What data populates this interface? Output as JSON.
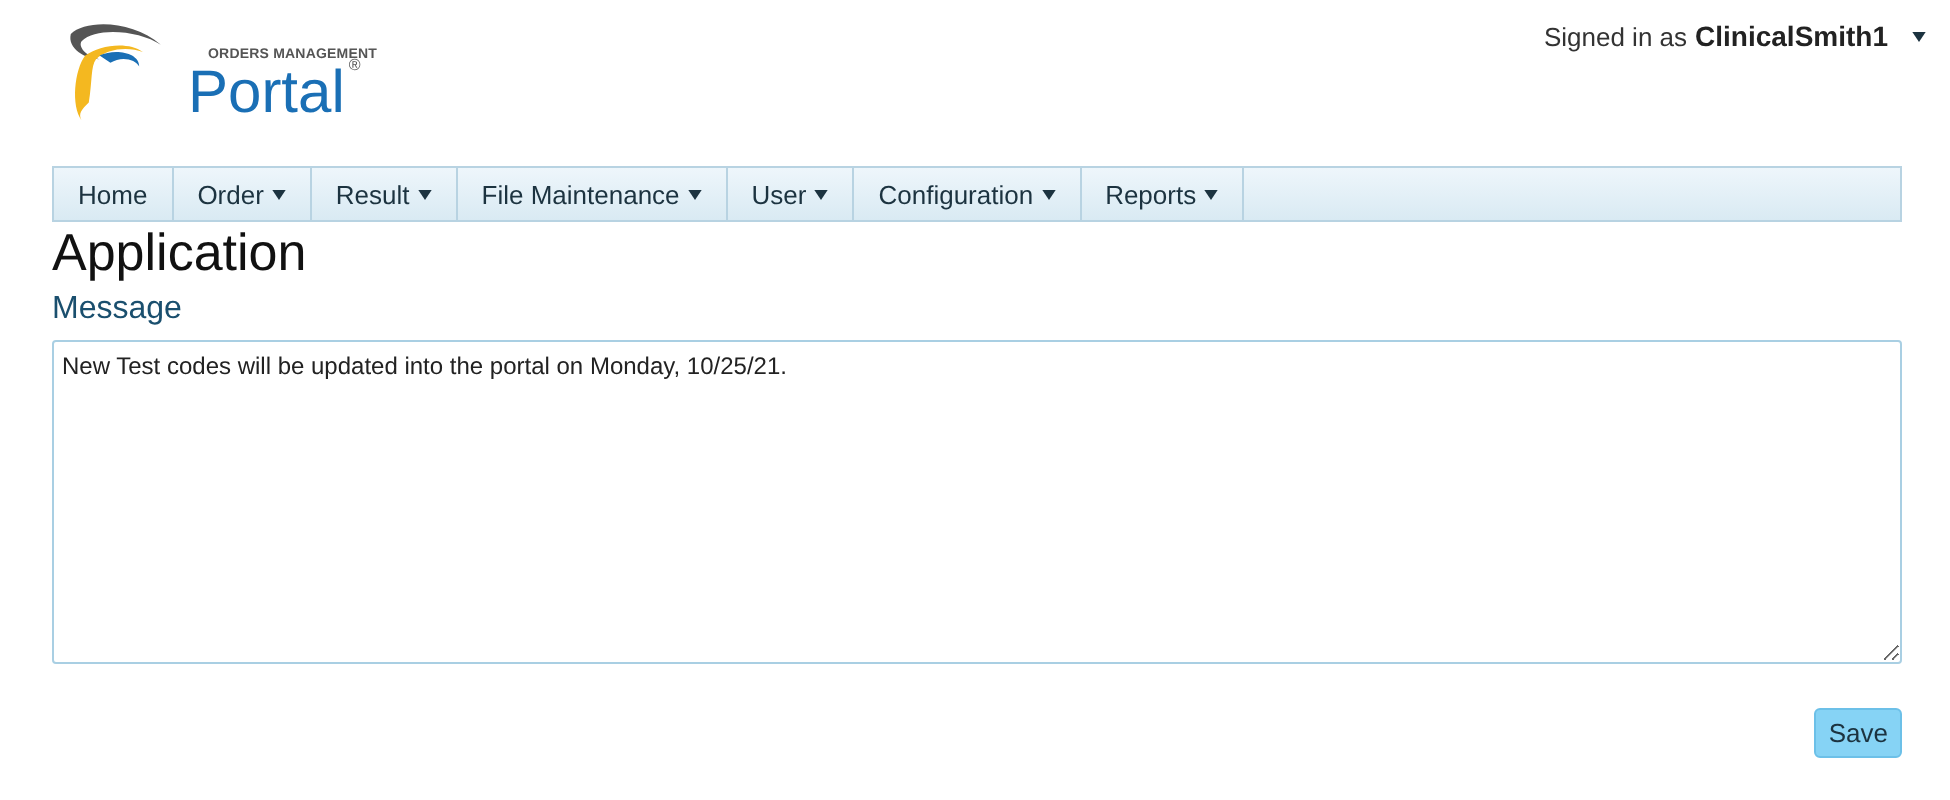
{
  "logo": {
    "tagline": "ORDERS MANAGEMENT",
    "name": "Portal",
    "mark": "®"
  },
  "user_menu": {
    "prefix": "Signed in as",
    "username": "ClinicalSmith1",
    "has_menu": true
  },
  "nav": [
    {
      "label": "Home",
      "has_menu": false
    },
    {
      "label": "Order",
      "has_menu": true
    },
    {
      "label": "Result",
      "has_menu": true
    },
    {
      "label": "File Maintenance",
      "has_menu": true
    },
    {
      "label": "User",
      "has_menu": true
    },
    {
      "label": "Configuration",
      "has_menu": true
    },
    {
      "label": "Reports",
      "has_menu": true
    }
  ],
  "page_title": "Application",
  "message": {
    "label": "Message",
    "value": "New Test codes will be updated into the portal on Monday, 10/25/21. "
  },
  "buttons": [
    {
      "label": "Save"
    }
  ]
}
